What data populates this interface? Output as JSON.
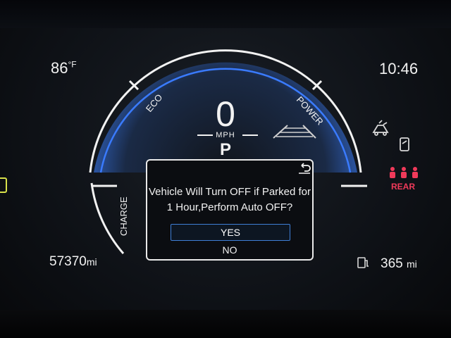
{
  "status": {
    "outside_temp": "86",
    "temp_unit": "°F",
    "clock": "10:46"
  },
  "gauge": {
    "eco_label": "ECO",
    "power_label": "POWER",
    "charge_label": "CHARGE",
    "accent_color": "#3a7bff"
  },
  "speed": {
    "value": "0",
    "unit": "MPH",
    "gear": "P"
  },
  "dialog": {
    "line1": "Vehicle Will Turn OFF if Parked for",
    "line2": "1 Hour,Perform Auto OFF?",
    "yes_label": "YES",
    "no_label": "NO"
  },
  "odometer": {
    "value": "57370",
    "unit": "mi"
  },
  "range": {
    "value": "365",
    "unit": "mi"
  },
  "indicators": {
    "rear_seatbelt_label": "REAR",
    "rear_seatbelt_color": "#f03a5a"
  }
}
